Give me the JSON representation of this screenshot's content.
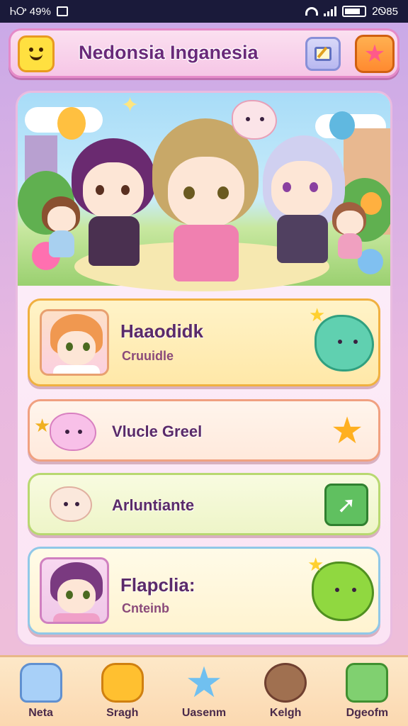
{
  "status_bar": {
    "left_text": "ᏂᎤ 49%",
    "time": "ᒿᏫ85"
  },
  "header": {
    "title": "Nedonsia Inganesia"
  },
  "menu": {
    "items": [
      {
        "title": "Haaodidk",
        "subtitle": "Cruuidle"
      },
      {
        "title": "Vlucle Greel"
      },
      {
        "title": "Arluntiante"
      },
      {
        "title": "Flapclia:",
        "subtitle": "Cnteinb"
      }
    ]
  },
  "bottom_nav": {
    "items": [
      {
        "label": "Neta",
        "icon": "cat-icon"
      },
      {
        "label": "Sragh",
        "icon": "blob-icon"
      },
      {
        "label": "Uasenm",
        "icon": "star-icon"
      },
      {
        "label": "Kelgh",
        "icon": "bear-icon"
      },
      {
        "label": "Dgeofm",
        "icon": "chat-icon"
      }
    ]
  },
  "colors": {
    "accent": "#e58ac8",
    "title_text": "#5a2a6a",
    "nav_bg": "#fde8c8"
  }
}
